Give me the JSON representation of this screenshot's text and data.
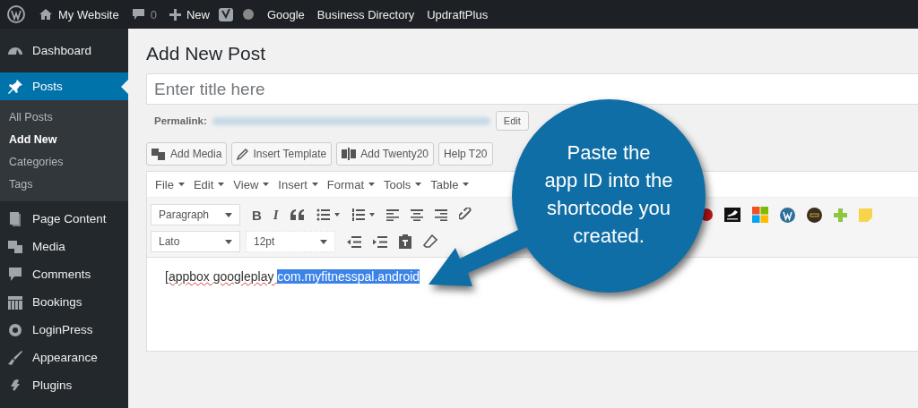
{
  "admin_bar": {
    "items": [
      {
        "kind": "logo"
      },
      {
        "kind": "site",
        "label": "My Website"
      },
      {
        "kind": "comments",
        "label": "0"
      },
      {
        "kind": "new",
        "label": "New"
      },
      {
        "kind": "seo"
      },
      {
        "kind": "status"
      },
      {
        "kind": "link",
        "label": "Google"
      },
      {
        "kind": "link",
        "label": "Business Directory"
      },
      {
        "kind": "link",
        "label": "UpdraftPlus"
      }
    ]
  },
  "sidebar": {
    "items": [
      {
        "kind": "dashboard",
        "label": "Dashboard",
        "selected": false
      },
      {
        "kind": "pin",
        "label": "Posts",
        "selected": true,
        "children": [
          {
            "label": "All Posts",
            "selected": false
          },
          {
            "label": "Add New",
            "selected": true
          },
          {
            "label": "Categories",
            "selected": false
          },
          {
            "label": "Tags",
            "selected": false
          }
        ]
      },
      {
        "kind": "pages",
        "label": "Page Content",
        "selected": false
      },
      {
        "kind": "media",
        "label": "Media",
        "selected": false
      },
      {
        "kind": "comments",
        "label": "Comments",
        "selected": false
      },
      {
        "kind": "calendar",
        "label": "Bookings",
        "selected": false
      },
      {
        "kind": "gear",
        "label": "LoginPress",
        "selected": false
      },
      {
        "kind": "brush",
        "label": "Appearance",
        "selected": false
      },
      {
        "kind": "plug",
        "label": "Plugins",
        "selected": false
      }
    ]
  },
  "page_title": "Add New Post",
  "title_field": {
    "placeholder": "Enter title here"
  },
  "permalink": {
    "label": "Permalink:",
    "button": "Edit"
  },
  "media_buttons": [
    {
      "kind": "media",
      "label": "Add Media"
    },
    {
      "kind": "pencil",
      "label": "Insert Template"
    },
    {
      "kind": "compare",
      "label": "Add Twenty20"
    },
    {
      "kind": "plain",
      "label": "Help T20"
    }
  ],
  "editor": {
    "menu": [
      "File",
      "Edit",
      "View",
      "Insert",
      "Format",
      "Tools",
      "Table"
    ],
    "format_select": "Paragraph",
    "font_select": "Lato",
    "size_select": "12pt",
    "row1": [
      {
        "kind": "bold",
        "label": "B"
      },
      {
        "kind": "italic",
        "label": "I"
      },
      {
        "kind": "quote"
      },
      {
        "kind": "bullets"
      },
      {
        "kind": "numbers"
      },
      {
        "kind": "align-left"
      },
      {
        "kind": "align-center"
      },
      {
        "kind": "align-right"
      },
      {
        "kind": "link"
      }
    ],
    "row1_plugins": [
      {
        "kind": "red-dot"
      },
      {
        "kind": "steam"
      },
      {
        "kind": "tiles"
      },
      {
        "kind": "wp"
      },
      {
        "kind": "dark"
      },
      {
        "kind": "plus"
      },
      {
        "kind": "note"
      }
    ],
    "row2": [
      {
        "kind": "outdent"
      },
      {
        "kind": "indent"
      },
      {
        "kind": "paste"
      },
      {
        "kind": "eraser"
      }
    ],
    "content": {
      "text": "[appbox googleplay ",
      "selected_text": "com.myfitnesspal.android"
    }
  },
  "callout": {
    "lines": [
      "Paste the",
      "app ID into the",
      "shortcode you",
      "created."
    ]
  }
}
